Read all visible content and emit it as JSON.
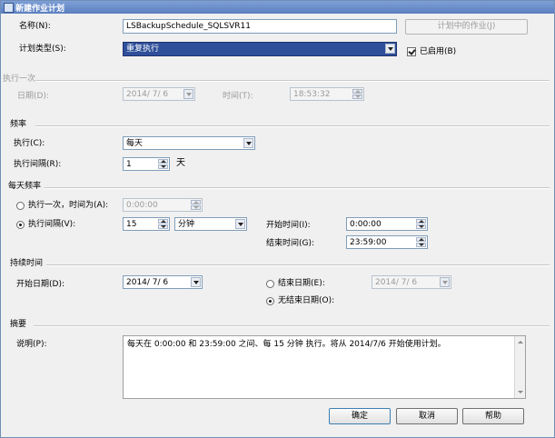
{
  "window": {
    "title": "新建作业计划"
  },
  "name_row": {
    "label": "名称(N):",
    "value": "LSBackupSchedule_SQLSVR11",
    "jobs_button": "计划中的作业(J)"
  },
  "schedule_type": {
    "label": "计划类型(S):",
    "value": "重复执行",
    "enabled_label": "已启用(B)"
  },
  "one_time": {
    "section": "执行一次",
    "date_label": "日期(D):",
    "date_value": "2014/ 7/ 6",
    "time_label": "时间(T):",
    "time_value": "18:53:32"
  },
  "frequency": {
    "section": "频率",
    "occurs_label": "执行(C):",
    "occurs_value": "每天",
    "recurs_label": "执行间隔(R):",
    "recurs_value": "1",
    "recurs_unit": "天"
  },
  "daily": {
    "section": "每天频率",
    "once_label": "执行一次，时间为(A):",
    "once_value": "0:00:00",
    "every_label": "执行间隔(V):",
    "every_value": "15",
    "every_unit": "分钟",
    "start_label": "开始时间(I):",
    "start_value": "0:00:00",
    "end_label": "结束时间(G):",
    "end_value": "23:59:00"
  },
  "duration": {
    "section": "持续时间",
    "start_label": "开始日期(D):",
    "start_value": "2014/ 7/ 6",
    "end_label": "结束日期(E):",
    "end_value": "2014/ 7/ 6",
    "noend_label": "无结束日期(O):"
  },
  "summary": {
    "section": "摘要",
    "desc_label": "说明(P):",
    "desc_value": "每天在 0:00:00 和 23:59:00 之间、每 15 分钟 执行。将从 2014/7/6 开始使用计划。"
  },
  "buttons": {
    "ok": "确定",
    "cancel": "取消",
    "help": "帮助"
  }
}
